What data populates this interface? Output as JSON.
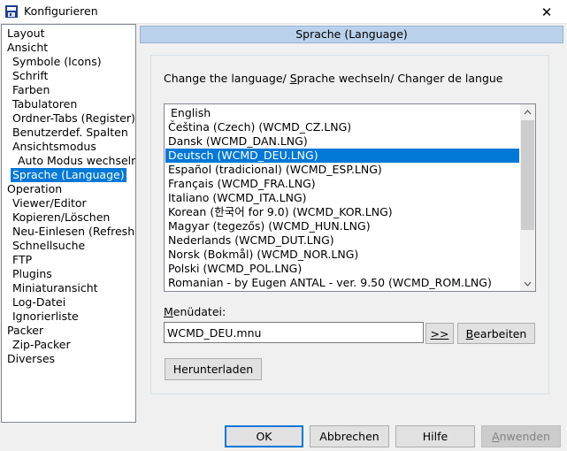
{
  "window": {
    "title": "Konfigurieren",
    "close_glyph": "✕"
  },
  "tree": {
    "items": [
      {
        "label": "Layout",
        "level": 0
      },
      {
        "label": "Ansicht",
        "level": 0
      },
      {
        "label": "Symbole (Icons)",
        "level": 1
      },
      {
        "label": "Schrift",
        "level": 1
      },
      {
        "label": "Farben",
        "level": 1
      },
      {
        "label": "Tabulatoren",
        "level": 1
      },
      {
        "label": "Ordner-Tabs (Register)",
        "level": 1
      },
      {
        "label": "Benutzerdef. Spalten",
        "level": 1
      },
      {
        "label": "Ansichtsmodus",
        "level": 1
      },
      {
        "label": "Auto Modus wechseln",
        "level": 2
      },
      {
        "label": "Sprache (Language)",
        "level": 1,
        "selected": true
      },
      {
        "label": "Operation",
        "level": 0
      },
      {
        "label": "Viewer/Editor",
        "level": 1
      },
      {
        "label": "Kopieren/Löschen",
        "level": 1
      },
      {
        "label": "Neu-Einlesen (Refresh)",
        "level": 1
      },
      {
        "label": "Schnellsuche",
        "level": 1
      },
      {
        "label": "FTP",
        "level": 1
      },
      {
        "label": "Plugins",
        "level": 1
      },
      {
        "label": "Miniaturansicht",
        "level": 1
      },
      {
        "label": "Log-Datei",
        "level": 1
      },
      {
        "label": "Ignorierliste",
        "level": 1
      },
      {
        "label": "Packer",
        "level": 0
      },
      {
        "label": "Zip-Packer",
        "level": 1
      },
      {
        "label": "Diverses",
        "level": 0
      }
    ]
  },
  "section_header": "Sprache (Language)",
  "change_language": {
    "before": "Change the language/ ",
    "accel": "S",
    "after": "prache wechseln/ Changer de langue"
  },
  "languages": [
    {
      "label": "English"
    },
    {
      "label": "Čeština (Czech) (WCMD_CZ.LNG)"
    },
    {
      "label": "Dansk (WCMD_DAN.LNG)"
    },
    {
      "label": "Deutsch (WCMD_DEU.LNG)",
      "selected": true
    },
    {
      "label": "Español (tradicional) (WCMD_ESP.LNG)"
    },
    {
      "label": "Français (WCMD_FRA.LNG)"
    },
    {
      "label": "Italiano (WCMD_ITA.LNG)"
    },
    {
      "label": "Korean (한국어 for 9.0) (WCMD_KOR.LNG)"
    },
    {
      "label": "Magyar (tegezős) (WCMD_HUN.LNG)"
    },
    {
      "label": "Nederlands (WCMD_DUT.LNG)"
    },
    {
      "label": "Norsk (Bokmål) (WCMD_NOR.LNG)"
    },
    {
      "label": "Polski (WCMD_POL.LNG)"
    },
    {
      "label": "Romanian - by Eugen ANTAL - ver. 9.50 (WCMD_ROM.LNG)"
    }
  ],
  "menu_file": {
    "label_accel": "M",
    "label_rest": "enüdatei:",
    "value": "WCMD_DEU.mnu",
    "browse_label": ">>",
    "edit_accel": "B",
    "edit_rest": "earbeiten"
  },
  "download_label": "Herunterladen",
  "footer": {
    "ok": "OK",
    "cancel": "Abbrechen",
    "help": "Hilfe",
    "apply_accel": "A",
    "apply_rest": "nwenden"
  },
  "colors": {
    "selection": "#0078d7",
    "header_bg": "#b9d1ea"
  }
}
